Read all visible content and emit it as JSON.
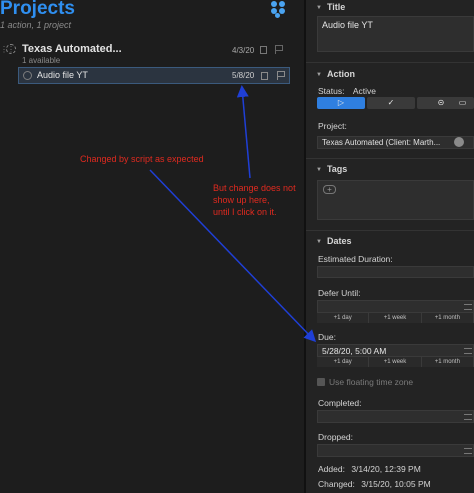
{
  "left_pane": {
    "title": "Projects",
    "subtitle": "1 action, 1 project",
    "project": {
      "name": "Texas Automated...",
      "status": "1 available",
      "date": "4/3/20"
    },
    "task": {
      "name": "Audio file YT",
      "date": "5/8/20"
    }
  },
  "annotations": {
    "note1": "Changed by script as expected",
    "note2_lines": [
      "But change does not",
      "show up here,",
      "until I click on it."
    ],
    "color": "#e02a1f",
    "arrow_color": "#1f3fd6"
  },
  "inspector": {
    "title_section": "Title",
    "title_value": "Audio file YT",
    "action_section": "Action",
    "status_label": "Status:",
    "status_value": "Active",
    "project_label": "Project:",
    "project_value": "Texas Automated (Client: Marth...",
    "tags_section": "Tags",
    "dates_section": "Dates",
    "estimated_duration_label": "Estimated Duration:",
    "defer_label": "Defer Until:",
    "quick_buttons": [
      "+1 day",
      "+1 week",
      "+1 month"
    ],
    "due_label": "Due:",
    "due_value": "5/28/20, 5:00 AM",
    "floating_label": "Use floating time zone",
    "completed_label": "Completed:",
    "dropped_label": "Dropped:",
    "added_label": "Added:",
    "added_value": "3/14/20, 12:39 PM",
    "changed_label": "Changed:",
    "changed_value": "3/15/20, 10:05 PM"
  },
  "colors": {
    "accent": "#2f8ff0",
    "active_button": "#2f7fe0"
  }
}
